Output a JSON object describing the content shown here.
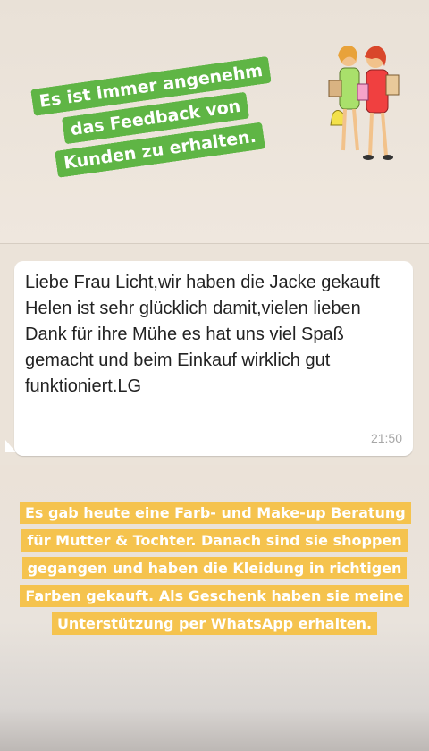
{
  "story": {
    "caption_top": "Es ist immer angenehm das Feedback von Kunden zu erhalten.",
    "caption_bottom": "Es gab heute eine Farb- und Make-up Beratung für Mutter & Tochter. Danach sind sie shoppen gegangen und haben die Kleidung in richtigen Farben gekauft. Als Geschenk haben sie meine Unterstützung per WhatsApp erhalten."
  },
  "chat": {
    "message": "Liebe Frau Licht,wir haben die Jacke gekauft  Helen ist sehr glücklich damit,vielen lieben Dank für ihre Mühe es hat uns viel Spaß gemacht und beim Einkauf wirklich gut funktioniert.LG",
    "time": "21:50"
  },
  "colors": {
    "green_caption_bg": "#5fb545",
    "yellow_caption_bg": "#f5c34e",
    "bubble_bg": "#ffffff"
  },
  "icons": {
    "sticker": "two-shopping-women-sticker"
  }
}
